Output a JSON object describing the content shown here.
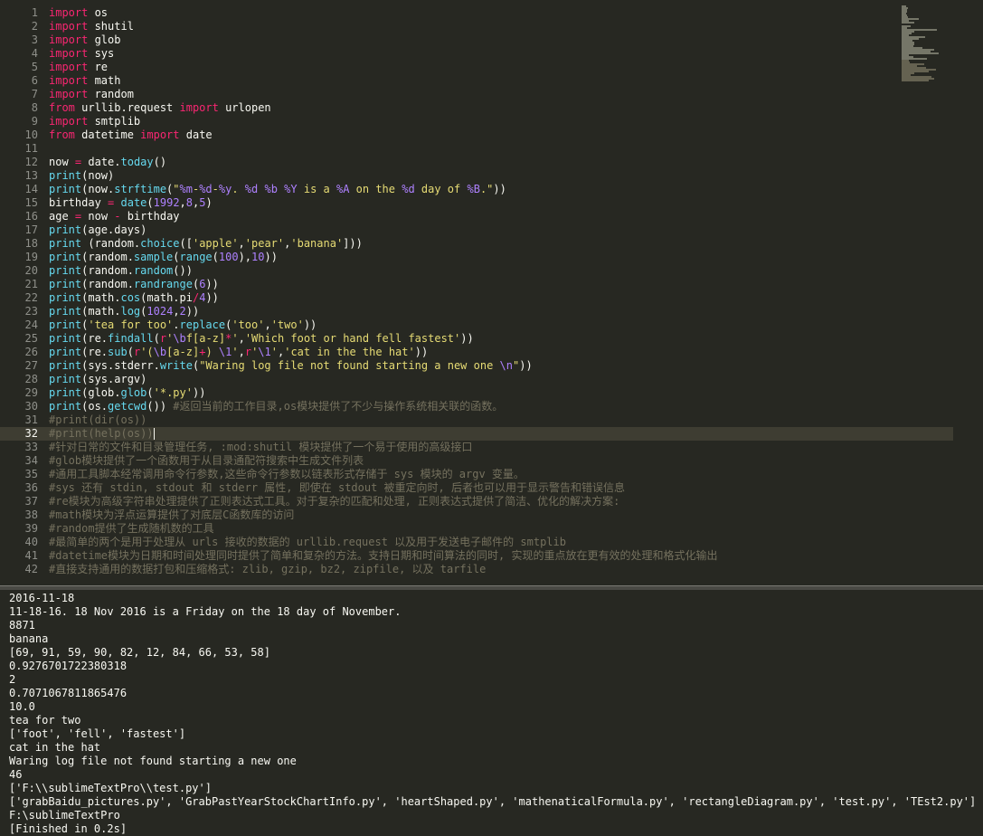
{
  "editor": {
    "active_line": 32,
    "lines": [
      [
        [
          "kw",
          "import"
        ],
        [
          "t",
          " os"
        ]
      ],
      [
        [
          "kw",
          "import"
        ],
        [
          "t",
          " shutil"
        ]
      ],
      [
        [
          "kw",
          "import"
        ],
        [
          "t",
          " glob"
        ]
      ],
      [
        [
          "kw",
          "import"
        ],
        [
          "t",
          " sys"
        ]
      ],
      [
        [
          "kw",
          "import"
        ],
        [
          "t",
          " re"
        ]
      ],
      [
        [
          "kw",
          "import"
        ],
        [
          "t",
          " math"
        ]
      ],
      [
        [
          "kw",
          "import"
        ],
        [
          "t",
          " random"
        ]
      ],
      [
        [
          "kw",
          "from"
        ],
        [
          "t",
          " urllib.request "
        ],
        [
          "kw",
          "import"
        ],
        [
          "t",
          " urlopen"
        ]
      ],
      [
        [
          "kw",
          "import"
        ],
        [
          "t",
          " smtplib"
        ]
      ],
      [
        [
          "kw",
          "from"
        ],
        [
          "t",
          " datetime "
        ],
        [
          "kw",
          "import"
        ],
        [
          "t",
          " date"
        ]
      ],
      [],
      [
        [
          "t",
          "now "
        ],
        [
          "op",
          "="
        ],
        [
          "t",
          " date."
        ],
        [
          "fn",
          "today"
        ],
        [
          "t",
          "()"
        ]
      ],
      [
        [
          "fn",
          "print"
        ],
        [
          "t",
          "(now)"
        ]
      ],
      [
        [
          "fn",
          "print"
        ],
        [
          "t",
          "(now."
        ],
        [
          "fn",
          "strftime"
        ],
        [
          "t",
          "("
        ],
        [
          "str",
          "\""
        ],
        [
          "num",
          "%m"
        ],
        [
          "str",
          "-"
        ],
        [
          "num",
          "%d"
        ],
        [
          "str",
          "-"
        ],
        [
          "num",
          "%y"
        ],
        [
          "str",
          ". "
        ],
        [
          "num",
          "%d"
        ],
        [
          "str",
          " "
        ],
        [
          "num",
          "%b"
        ],
        [
          "str",
          " "
        ],
        [
          "num",
          "%Y"
        ],
        [
          "str",
          " is a "
        ],
        [
          "num",
          "%A"
        ],
        [
          "str",
          " on the "
        ],
        [
          "num",
          "%d"
        ],
        [
          "str",
          " day of "
        ],
        [
          "num",
          "%B"
        ],
        [
          "str",
          ".\""
        ],
        [
          "t",
          "))"
        ]
      ],
      [
        [
          "t",
          "birthday "
        ],
        [
          "op",
          "="
        ],
        [
          "t",
          " "
        ],
        [
          "fn",
          "date"
        ],
        [
          "t",
          "("
        ],
        [
          "num",
          "1992"
        ],
        [
          "t",
          ","
        ],
        [
          "num",
          "8"
        ],
        [
          "t",
          ","
        ],
        [
          "num",
          "5"
        ],
        [
          "t",
          ")"
        ]
      ],
      [
        [
          "t",
          "age "
        ],
        [
          "op",
          "="
        ],
        [
          "t",
          " now "
        ],
        [
          "op",
          "-"
        ],
        [
          "t",
          " birthday"
        ]
      ],
      [
        [
          "fn",
          "print"
        ],
        [
          "t",
          "(age.days)"
        ]
      ],
      [
        [
          "fn",
          "print"
        ],
        [
          "t",
          " (random."
        ],
        [
          "fn",
          "choice"
        ],
        [
          "t",
          "(["
        ],
        [
          "str",
          "'apple'"
        ],
        [
          "t",
          ","
        ],
        [
          "str",
          "'pear'"
        ],
        [
          "t",
          ","
        ],
        [
          "str",
          "'banana'"
        ],
        [
          "t",
          "]))"
        ]
      ],
      [
        [
          "fn",
          "print"
        ],
        [
          "t",
          "(random."
        ],
        [
          "fn",
          "sample"
        ],
        [
          "t",
          "("
        ],
        [
          "fn",
          "range"
        ],
        [
          "t",
          "("
        ],
        [
          "num",
          "100"
        ],
        [
          "t",
          "),"
        ],
        [
          "num",
          "10"
        ],
        [
          "t",
          "))"
        ]
      ],
      [
        [
          "fn",
          "print"
        ],
        [
          "t",
          "(random."
        ],
        [
          "fn",
          "random"
        ],
        [
          "t",
          "())"
        ]
      ],
      [
        [
          "fn",
          "print"
        ],
        [
          "t",
          "(random."
        ],
        [
          "fn",
          "randrange"
        ],
        [
          "t",
          "("
        ],
        [
          "num",
          "6"
        ],
        [
          "t",
          "))"
        ]
      ],
      [
        [
          "fn",
          "print"
        ],
        [
          "t",
          "(math."
        ],
        [
          "fn",
          "cos"
        ],
        [
          "t",
          "(math.pi"
        ],
        [
          "op",
          "/"
        ],
        [
          "num",
          "4"
        ],
        [
          "t",
          "))"
        ]
      ],
      [
        [
          "fn",
          "print"
        ],
        [
          "t",
          "(math."
        ],
        [
          "fn",
          "log"
        ],
        [
          "t",
          "("
        ],
        [
          "num",
          "1024"
        ],
        [
          "t",
          ","
        ],
        [
          "num",
          "2"
        ],
        [
          "t",
          "))"
        ]
      ],
      [
        [
          "fn",
          "print"
        ],
        [
          "t",
          "("
        ],
        [
          "str",
          "'tea for too'"
        ],
        [
          "t",
          "."
        ],
        [
          "fn",
          "replace"
        ],
        [
          "t",
          "("
        ],
        [
          "str",
          "'too'"
        ],
        [
          "t",
          ","
        ],
        [
          "str",
          "'two'"
        ],
        [
          "t",
          "))"
        ]
      ],
      [
        [
          "fn",
          "print"
        ],
        [
          "t",
          "(re."
        ],
        [
          "fn",
          "findall"
        ],
        [
          "t",
          "("
        ],
        [
          "kw",
          "r"
        ],
        [
          "str",
          "'"
        ],
        [
          "num",
          "\\b"
        ],
        [
          "str",
          "f[a-z]"
        ],
        [
          "op",
          "*"
        ],
        [
          "str",
          "'"
        ],
        [
          "t",
          ","
        ],
        [
          "str",
          "'Which foot or hand fell fastest'"
        ],
        [
          "t",
          "))"
        ]
      ],
      [
        [
          "fn",
          "print"
        ],
        [
          "t",
          "(re."
        ],
        [
          "fn",
          "sub"
        ],
        [
          "t",
          "("
        ],
        [
          "kw",
          "r"
        ],
        [
          "str",
          "'("
        ],
        [
          "num",
          "\\b"
        ],
        [
          "str",
          "[a-z]"
        ],
        [
          "op",
          "+"
        ],
        [
          "str",
          ") "
        ],
        [
          "num",
          "\\1"
        ],
        [
          "str",
          "'"
        ],
        [
          "t",
          ","
        ],
        [
          "kw",
          "r"
        ],
        [
          "str",
          "'"
        ],
        [
          "num",
          "\\1"
        ],
        [
          "str",
          "'"
        ],
        [
          "t",
          ","
        ],
        [
          "str",
          "'cat in the the hat'"
        ],
        [
          "t",
          "))"
        ]
      ],
      [
        [
          "fn",
          "print"
        ],
        [
          "t",
          "(sys.stderr."
        ],
        [
          "fn",
          "write"
        ],
        [
          "t",
          "("
        ],
        [
          "str",
          "\"Waring log file not found starting a new one "
        ],
        [
          "num",
          "\\n"
        ],
        [
          "str",
          "\""
        ],
        [
          "t",
          "))"
        ]
      ],
      [
        [
          "fn",
          "print"
        ],
        [
          "t",
          "(sys.argv)"
        ]
      ],
      [
        [
          "fn",
          "print"
        ],
        [
          "t",
          "(glob."
        ],
        [
          "fn",
          "glob"
        ],
        [
          "t",
          "("
        ],
        [
          "str",
          "'*.py'"
        ],
        [
          "t",
          "))"
        ]
      ],
      [
        [
          "fn",
          "print"
        ],
        [
          "t",
          "(os."
        ],
        [
          "fn",
          "getcwd"
        ],
        [
          "t",
          "()) "
        ],
        [
          "cmt",
          "#返回当前的工作目录,os模块提供了不少与操作系统相关联的函数。"
        ]
      ],
      [
        [
          "cmt",
          "#print(dir(os))"
        ]
      ],
      [
        [
          "cmt",
          "#print(help(os))"
        ],
        [
          "cursor",
          ""
        ]
      ],
      [
        [
          "cmt",
          "#针对日常的文件和目录管理任务, :mod:shutil 模块提供了一个易于使用的高级接口"
        ]
      ],
      [
        [
          "cmt",
          "#glob模块提供了一个函数用于从目录通配符搜索中生成文件列表"
        ]
      ],
      [
        [
          "cmt",
          "#通用工具脚本经常调用命令行参数,这些命令行参数以链表形式存储于 sys 模块的 argv 变量。"
        ]
      ],
      [
        [
          "cmt",
          "#sys 还有 stdin, stdout 和 stderr 属性, 即使在 stdout 被重定向时, 后者也可以用于显示警告和错误信息"
        ]
      ],
      [
        [
          "cmt",
          "#re模块为高级字符串处理提供了正则表达式工具。对于复杂的匹配和处理, 正则表达式提供了简洁、优化的解决方案:"
        ]
      ],
      [
        [
          "cmt",
          "#math模块为浮点运算提供了对底层C函数库的访问"
        ]
      ],
      [
        [
          "cmt",
          "#random提供了生成随机数的工具"
        ]
      ],
      [
        [
          "cmt",
          "#最简单的两个是用于处理从 urls 接收的数据的 urllib.request 以及用于发送电子邮件的 smtplib"
        ]
      ],
      [
        [
          "cmt",
          "#datetime模块为日期和时间处理同时提供了简单和复杂的方法。支持日期和时间算法的同时, 实现的重点放在更有效的处理和格式化输出"
        ]
      ],
      [
        [
          "cmt",
          "#直接支持通用的数据打包和压缩格式: zlib, gzip, bz2, zipfile, 以及 tarfile"
        ]
      ]
    ]
  },
  "output": {
    "lines": [
      "2016-11-18",
      "11-18-16. 18 Nov 2016 is a Friday on the 18 day of November.",
      "8871",
      "banana",
      "[69, 91, 59, 90, 82, 12, 84, 66, 53, 58]",
      "0.9276701722380318",
      "2",
      "0.7071067811865476",
      "10.0",
      "tea for two",
      "['foot', 'fell', 'fastest']",
      "cat in the hat",
      "Waring log file not found starting a new one",
      "46",
      "['F:\\\\sublimeTextPro\\\\test.py']",
      "['grabBaidu_pictures.py', 'GrabPastYearStockChartInfo.py', 'heartShaped.py', 'mathenaticalFormula.py', 'rectangleDiagram.py', 'test.py', 'TEst2.py']",
      "F:\\sublimeTextPro",
      "[Finished in 0.2s]"
    ]
  },
  "colors": {
    "background": "#272822",
    "keyword": "#f92672",
    "function": "#66d9ef",
    "string": "#e6db74",
    "number": "#ae81ff",
    "comment": "#75715e"
  }
}
